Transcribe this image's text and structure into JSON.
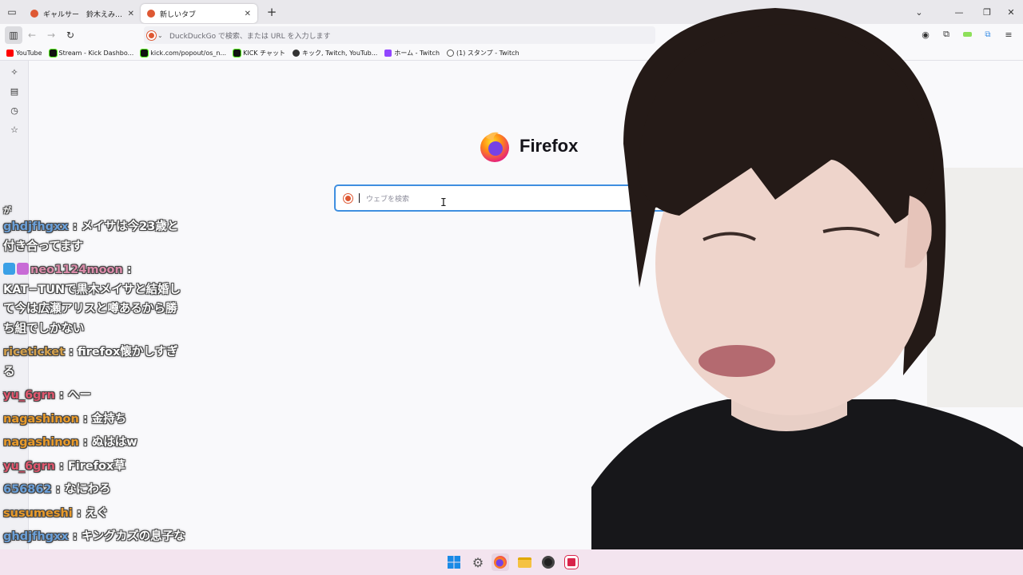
{
  "tabs": [
    {
      "title": "ギャルサー　鈴木えみ at DuckDuckGo",
      "favicon_color": "#de5833"
    },
    {
      "title": "新しいタブ",
      "favicon_color": "#de5833"
    }
  ],
  "urlbar": {
    "placeholder": "DuckDuckGo で検索、または URL を入力します"
  },
  "bookmarks": [
    {
      "label": "YouTube",
      "color": "#ff0000"
    },
    {
      "label": "Stream - Kick Dashbo...",
      "color": "#111111"
    },
    {
      "label": "kick.com/popout/os_n...",
      "color": "#111111"
    },
    {
      "label": "KICK チャット",
      "color": "#111111"
    },
    {
      "label": "キック, Twitch, YouTub...",
      "color": "#333333"
    },
    {
      "label": "ホーム - Twitch",
      "color": "#9146ff"
    },
    {
      "label": "(1) スタンプ - Twitch",
      "color": "#555555"
    }
  ],
  "newtab": {
    "brand": "Firefox",
    "search_placeholder": "ウェブを検索"
  },
  "chat": {
    "partial_top": "が",
    "messages": [
      {
        "user": "ghdjfhgxx",
        "user_color": "#6a9fd8",
        "text": "メイサは今23歳と付き合ってます",
        "badges": []
      },
      {
        "user": "neo1124moon",
        "user_color": "#d98aa8",
        "text": "KAT−TUNで黒木メイサと結婚して今は広瀬アリスと噂あるから勝ち組でしかない",
        "badges": [
          "#3aa0e6",
          "#c86bd6"
        ]
      },
      {
        "user": "riceticket",
        "user_color": "#d4a04a",
        "text": "firefox懐かしすぎる",
        "badges": []
      },
      {
        "user": "yu_6grn",
        "user_color": "#e0566d",
        "text": "へー",
        "badges": []
      },
      {
        "user": "nagashinon",
        "user_color": "#e89a2a",
        "text": "金持ち",
        "badges": []
      },
      {
        "user": "nagashinon",
        "user_color": "#e89a2a",
        "text": "ぬははw",
        "badges": []
      },
      {
        "user": "yu_6grn",
        "user_color": "#e0566d",
        "text": "Firefox草",
        "badges": []
      },
      {
        "user": "656862",
        "user_color": "#6a9fd8",
        "text": "なにわろ",
        "badges": []
      },
      {
        "user": "susumeshi",
        "user_color": "#e89a2a",
        "text": "えぐ",
        "badges": []
      },
      {
        "user": "ghdjfhgxx",
        "user_color": "#6a9fd8",
        "text": "キングカズの息子な",
        "badges": []
      }
    ]
  }
}
